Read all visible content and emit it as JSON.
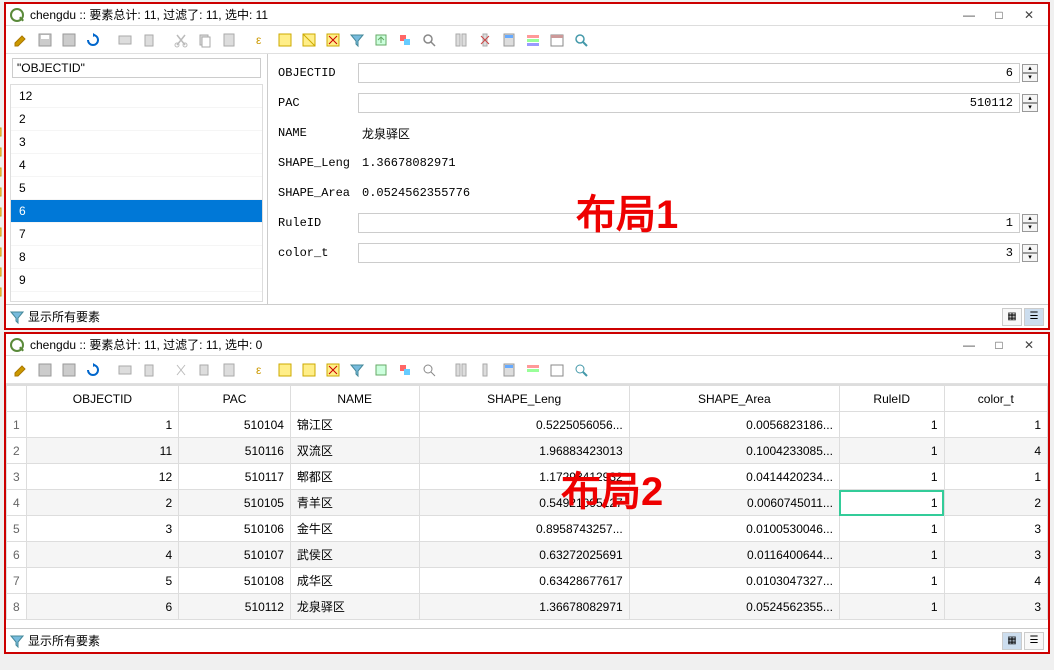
{
  "layout1": {
    "title": "chengdu :: 要素总计: 11, 过滤了: 11, 选中: 11",
    "overlay": "布局1",
    "field_name": "\"OBJECTID\"",
    "list": [
      "12",
      "2",
      "3",
      "4",
      "5",
      "6",
      "7",
      "8",
      "9"
    ],
    "selected_index": 5,
    "form": {
      "objectid_lbl": "OBJECTID",
      "objectid_val": "6",
      "pac_lbl": "PAC",
      "pac_val": "510112",
      "name_lbl": "NAME",
      "name_val": "龙泉驿区",
      "leng_lbl": "SHAPE_Leng",
      "leng_val": "1.36678082971",
      "area_lbl": "SHAPE_Area",
      "area_val": "0.0524562355776",
      "ruleid_lbl": "RuleID",
      "ruleid_val": "1",
      "color_lbl": "color_t",
      "color_val": "3"
    },
    "bottom": "显示所有要素"
  },
  "layout2": {
    "title": "chengdu :: 要素总计: 11, 过滤了: 11, 选中: 0",
    "overlay": "布局2",
    "cols": [
      "OBJECTID",
      "PAC",
      "NAME",
      "SHAPE_Leng",
      "SHAPE_Area",
      "RuleID",
      "color_t"
    ],
    "rows": [
      {
        "n": "1",
        "OBJECTID": "1",
        "PAC": "510104",
        "NAME": "锦江区",
        "SHAPE_Leng": "0.5225056056...",
        "SHAPE_Area": "0.0056823186...",
        "RuleID": "1",
        "color_t": "1"
      },
      {
        "n": "2",
        "OBJECTID": "11",
        "PAC": "510116",
        "NAME": "双流区",
        "SHAPE_Leng": "1.96883423013",
        "SHAPE_Area": "0.1004233085...",
        "RuleID": "1",
        "color_t": "4"
      },
      {
        "n": "3",
        "OBJECTID": "12",
        "PAC": "510117",
        "NAME": "郫都区",
        "SHAPE_Leng": "1.17293412932",
        "SHAPE_Area": "0.0414420234...",
        "RuleID": "1",
        "color_t": "1"
      },
      {
        "n": "4",
        "OBJECTID": "2",
        "PAC": "510105",
        "NAME": "青羊区",
        "SHAPE_Leng": "0.54921095127",
        "SHAPE_Area": "0.0060745011...",
        "RuleID": "1",
        "color_t": "2",
        "hl": "RuleID"
      },
      {
        "n": "5",
        "OBJECTID": "3",
        "PAC": "510106",
        "NAME": "金牛区",
        "SHAPE_Leng": "0.8958743257...",
        "SHAPE_Area": "0.0100530046...",
        "RuleID": "1",
        "color_t": "3"
      },
      {
        "n": "6",
        "OBJECTID": "4",
        "PAC": "510107",
        "NAME": "武侯区",
        "SHAPE_Leng": "0.63272025691",
        "SHAPE_Area": "0.0116400644...",
        "RuleID": "1",
        "color_t": "3"
      },
      {
        "n": "7",
        "OBJECTID": "5",
        "PAC": "510108",
        "NAME": "成华区",
        "SHAPE_Leng": "0.63428677617",
        "SHAPE_Area": "0.0103047327...",
        "RuleID": "1",
        "color_t": "4"
      },
      {
        "n": "8",
        "OBJECTID": "6",
        "PAC": "510112",
        "NAME": "龙泉驿区",
        "SHAPE_Leng": "1.36678082971",
        "SHAPE_Area": "0.0524562355...",
        "RuleID": "1",
        "color_t": "3"
      }
    ],
    "bottom": "显示所有要素"
  }
}
